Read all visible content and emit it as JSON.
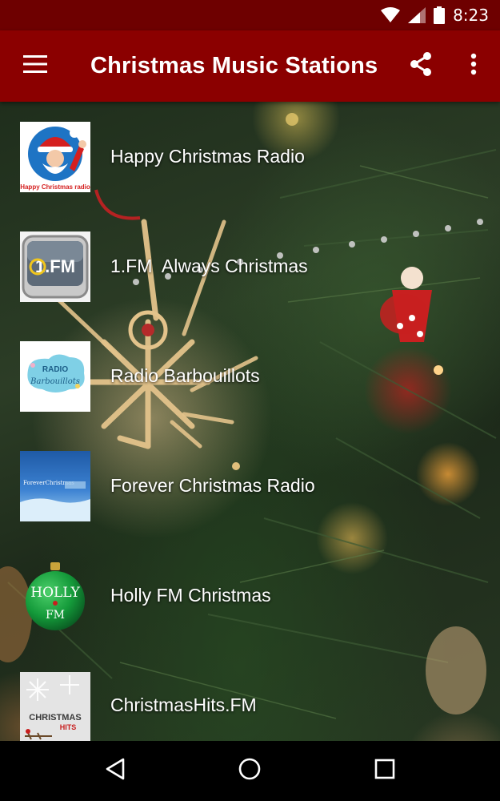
{
  "status_bar": {
    "time": "8:23",
    "icons": [
      "wifi-icon",
      "cell-signal-icon",
      "battery-icon"
    ]
  },
  "app_bar": {
    "title": "Christmas Music Stations",
    "menu_icon": "hamburger-menu-icon",
    "actions": [
      "share-icon",
      "overflow-menu-icon"
    ],
    "color": "#8b0000"
  },
  "stations": [
    {
      "name": "Happy Christmas Radio",
      "logo_text": "Happy Christmas radio"
    },
    {
      "name": "1.FM  Always Christmas",
      "logo_text": "1.FM"
    },
    {
      "name": "Radio Barbouillots",
      "logo_text_1": "RADIO",
      "logo_text_2": "Barbouillots"
    },
    {
      "name": "Forever Christmas Radio",
      "logo_text": "ForeverChristmas"
    },
    {
      "name": "Holly FM Christmas",
      "logo_text_1": "HOLLY",
      "logo_text_2": "FM"
    },
    {
      "name": "ChristmasHits.FM",
      "logo_text_1": "CHRISTMAS",
      "logo_text_2": "HITS"
    }
  ],
  "nav_bar": {
    "icons": [
      "back-icon",
      "home-icon",
      "recents-icon"
    ]
  }
}
